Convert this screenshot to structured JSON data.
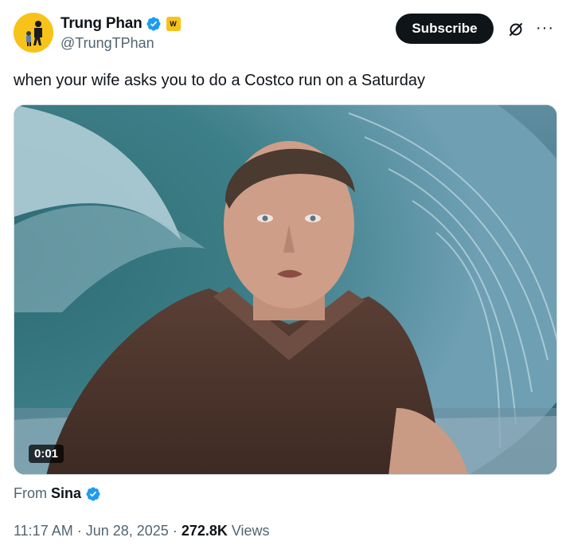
{
  "author": {
    "display_name": "Trung Phan",
    "handle": "@TrungTPhan",
    "verified": true,
    "affiliate_badge": "W"
  },
  "actions": {
    "subscribe_label": "Subscribe",
    "grok_icon": "slashed-circle-icon",
    "more_icon": "more-icon"
  },
  "tweet": {
    "text": "when your wife asks you to do a Costco run on a Saturday"
  },
  "media": {
    "video_time": "0:01"
  },
  "source": {
    "from_label": "From",
    "from_name": "Sina",
    "verified": true
  },
  "meta": {
    "time": "11:17 AM",
    "date": "Jun 28, 2025",
    "views_count": "272.8K",
    "views_label": "Views"
  },
  "colors": {
    "accent": "#1d9bf0",
    "text": "#0f1419",
    "muted": "#536471",
    "avatar_bg": "#f7c31a"
  }
}
